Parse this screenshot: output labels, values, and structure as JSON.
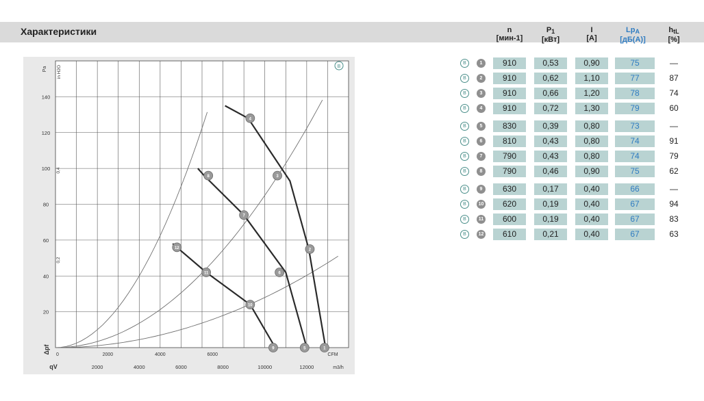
{
  "page": {
    "section_title": "Характеристики"
  },
  "table": {
    "headers": {
      "n": {
        "name": "n",
        "unit": "[мин-1]"
      },
      "p1": {
        "name": "P",
        "sub": "1",
        "unit": "[кВт]"
      },
      "i": {
        "name": "I",
        "unit": "[A]"
      },
      "lpa": {
        "name": "Lp",
        "sub": "A",
        "unit": "[дБ(A)]"
      },
      "htl": {
        "name": "h",
        "sub": "tL",
        "unit": "[%]"
      }
    },
    "badge_letter": "B",
    "rows": [
      {
        "id": "1",
        "n": "910",
        "p1": "0,53",
        "i": "0,90",
        "lpa": "75",
        "htl": "—"
      },
      {
        "id": "2",
        "n": "910",
        "p1": "0,62",
        "i": "1,10",
        "lpa": "77",
        "htl": "87"
      },
      {
        "id": "3",
        "n": "910",
        "p1": "0,66",
        "i": "1,20",
        "lpa": "78",
        "htl": "74"
      },
      {
        "id": "4",
        "n": "910",
        "p1": "0,72",
        "i": "1,30",
        "lpa": "79",
        "htl": "60"
      },
      {
        "id": "5",
        "n": "830",
        "p1": "0,39",
        "i": "0,80",
        "lpa": "73",
        "htl": "—"
      },
      {
        "id": "6",
        "n": "810",
        "p1": "0,43",
        "i": "0,80",
        "lpa": "74",
        "htl": "91"
      },
      {
        "id": "7",
        "n": "790",
        "p1": "0,43",
        "i": "0,80",
        "lpa": "74",
        "htl": "79"
      },
      {
        "id": "8",
        "n": "790",
        "p1": "0,46",
        "i": "0,90",
        "lpa": "75",
        "htl": "62"
      },
      {
        "id": "9",
        "n": "630",
        "p1": "0,17",
        "i": "0,40",
        "lpa": "66",
        "htl": "—"
      },
      {
        "id": "10",
        "n": "620",
        "p1": "0,19",
        "i": "0,40",
        "lpa": "67",
        "htl": "94"
      },
      {
        "id": "11",
        "n": "600",
        "p1": "0,19",
        "i": "0,40",
        "lpa": "67",
        "htl": "83"
      },
      {
        "id": "12",
        "n": "610",
        "p1": "0,21",
        "i": "0,40",
        "lpa": "67",
        "htl": "63"
      }
    ],
    "colors": {
      "cell": "#b9d3d2",
      "lpa_text": "#2f7cc1",
      "badge": "#4a8f8a",
      "marker": "#8f8f8f"
    }
  },
  "chart_data": {
    "type": "line",
    "badge_letter": "B",
    "y_axis_label": "Δpf",
    "y_axis_unit_left": "Pa",
    "y_axis_unit_right": "in H2O",
    "y_ticks_left": [
      20,
      40,
      60,
      80,
      100,
      120,
      140
    ],
    "y_ticks_right": [
      "0,2",
      "0,4"
    ],
    "ylim": [
      0,
      160
    ],
    "x_axis_label": "qV",
    "x_unit_top": "CFM",
    "x_unit_bottom": "m3/h",
    "x_ticks_top": [
      "0",
      "2000",
      "4000",
      "6000"
    ],
    "x_ticks_bottom": [
      "2000",
      "4000",
      "6000",
      "8000",
      "10000",
      "12000"
    ],
    "xlim": [
      0,
      14000
    ],
    "series": [
      {
        "x": [
          8100,
          9200,
          11200,
          12100,
          12900
        ],
        "y": [
          135,
          128,
          93,
          55,
          0
        ]
      },
      {
        "x": [
          6800,
          7100,
          9000,
          11000,
          12000
        ],
        "y": [
          100,
          96,
          74,
          42,
          0
        ]
      },
      {
        "x": [
          5600,
          5800,
          7200,
          9300,
          10500
        ],
        "y": [
          58,
          56,
          42,
          24,
          0
        ]
      }
    ],
    "operating_points": [
      {
        "id": "1",
        "x": 12850,
        "y": 0
      },
      {
        "id": "2",
        "x": 12150,
        "y": 55
      },
      {
        "id": "3",
        "x": 10600,
        "y": 96
      },
      {
        "id": "4",
        "x": 9300,
        "y": 128
      },
      {
        "id": "5",
        "x": 11900,
        "y": 0
      },
      {
        "id": "6",
        "x": 10700,
        "y": 42
      },
      {
        "id": "7",
        "x": 9000,
        "y": 74
      },
      {
        "id": "8",
        "x": 7300,
        "y": 96
      },
      {
        "id": "9",
        "x": 10400,
        "y": 0
      },
      {
        "id": "10",
        "x": 9300,
        "y": 24
      },
      {
        "id": "11",
        "x": 7200,
        "y": 42
      },
      {
        "id": "12",
        "x": 5800,
        "y": 56
      }
    ],
    "colors": {
      "curve": "#2a2a2a",
      "grid": "#555555",
      "system_curve": "#6f6f6f",
      "marker": "#9a9a9a"
    }
  }
}
